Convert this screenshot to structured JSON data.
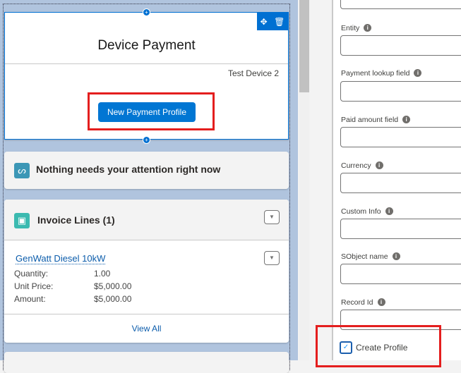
{
  "device_payment": {
    "title": "Device Payment",
    "device_name": "Test Device 2",
    "button_label": "New Payment Profile"
  },
  "attention": {
    "text": "Nothing needs your attention right now"
  },
  "invoice_lines": {
    "title": "Invoice Lines (1)",
    "item": {
      "name": "GenWatt Diesel 10kW",
      "fields": [
        {
          "label": "Quantity:",
          "value": "1.00"
        },
        {
          "label": "Unit Price:",
          "value": "$5,000.00"
        },
        {
          "label": "Amount:",
          "value": "$5,000.00"
        }
      ]
    },
    "view_all": "View All"
  },
  "properties": {
    "fields": [
      {
        "label": "Entity",
        "value": ""
      },
      {
        "label": "Payment lookup field",
        "value": ""
      },
      {
        "label": "Paid amount field",
        "value": ""
      },
      {
        "label": "Currency",
        "value": ""
      },
      {
        "label": "Custom Info",
        "value": ""
      },
      {
        "label": "SObject name",
        "value": ""
      },
      {
        "label": "Record Id",
        "value": ""
      }
    ],
    "checkbox": {
      "label": "Create Profile",
      "checked": true
    }
  },
  "colors": {
    "brand": "#0176d3",
    "highlight": "#e41e1e"
  }
}
